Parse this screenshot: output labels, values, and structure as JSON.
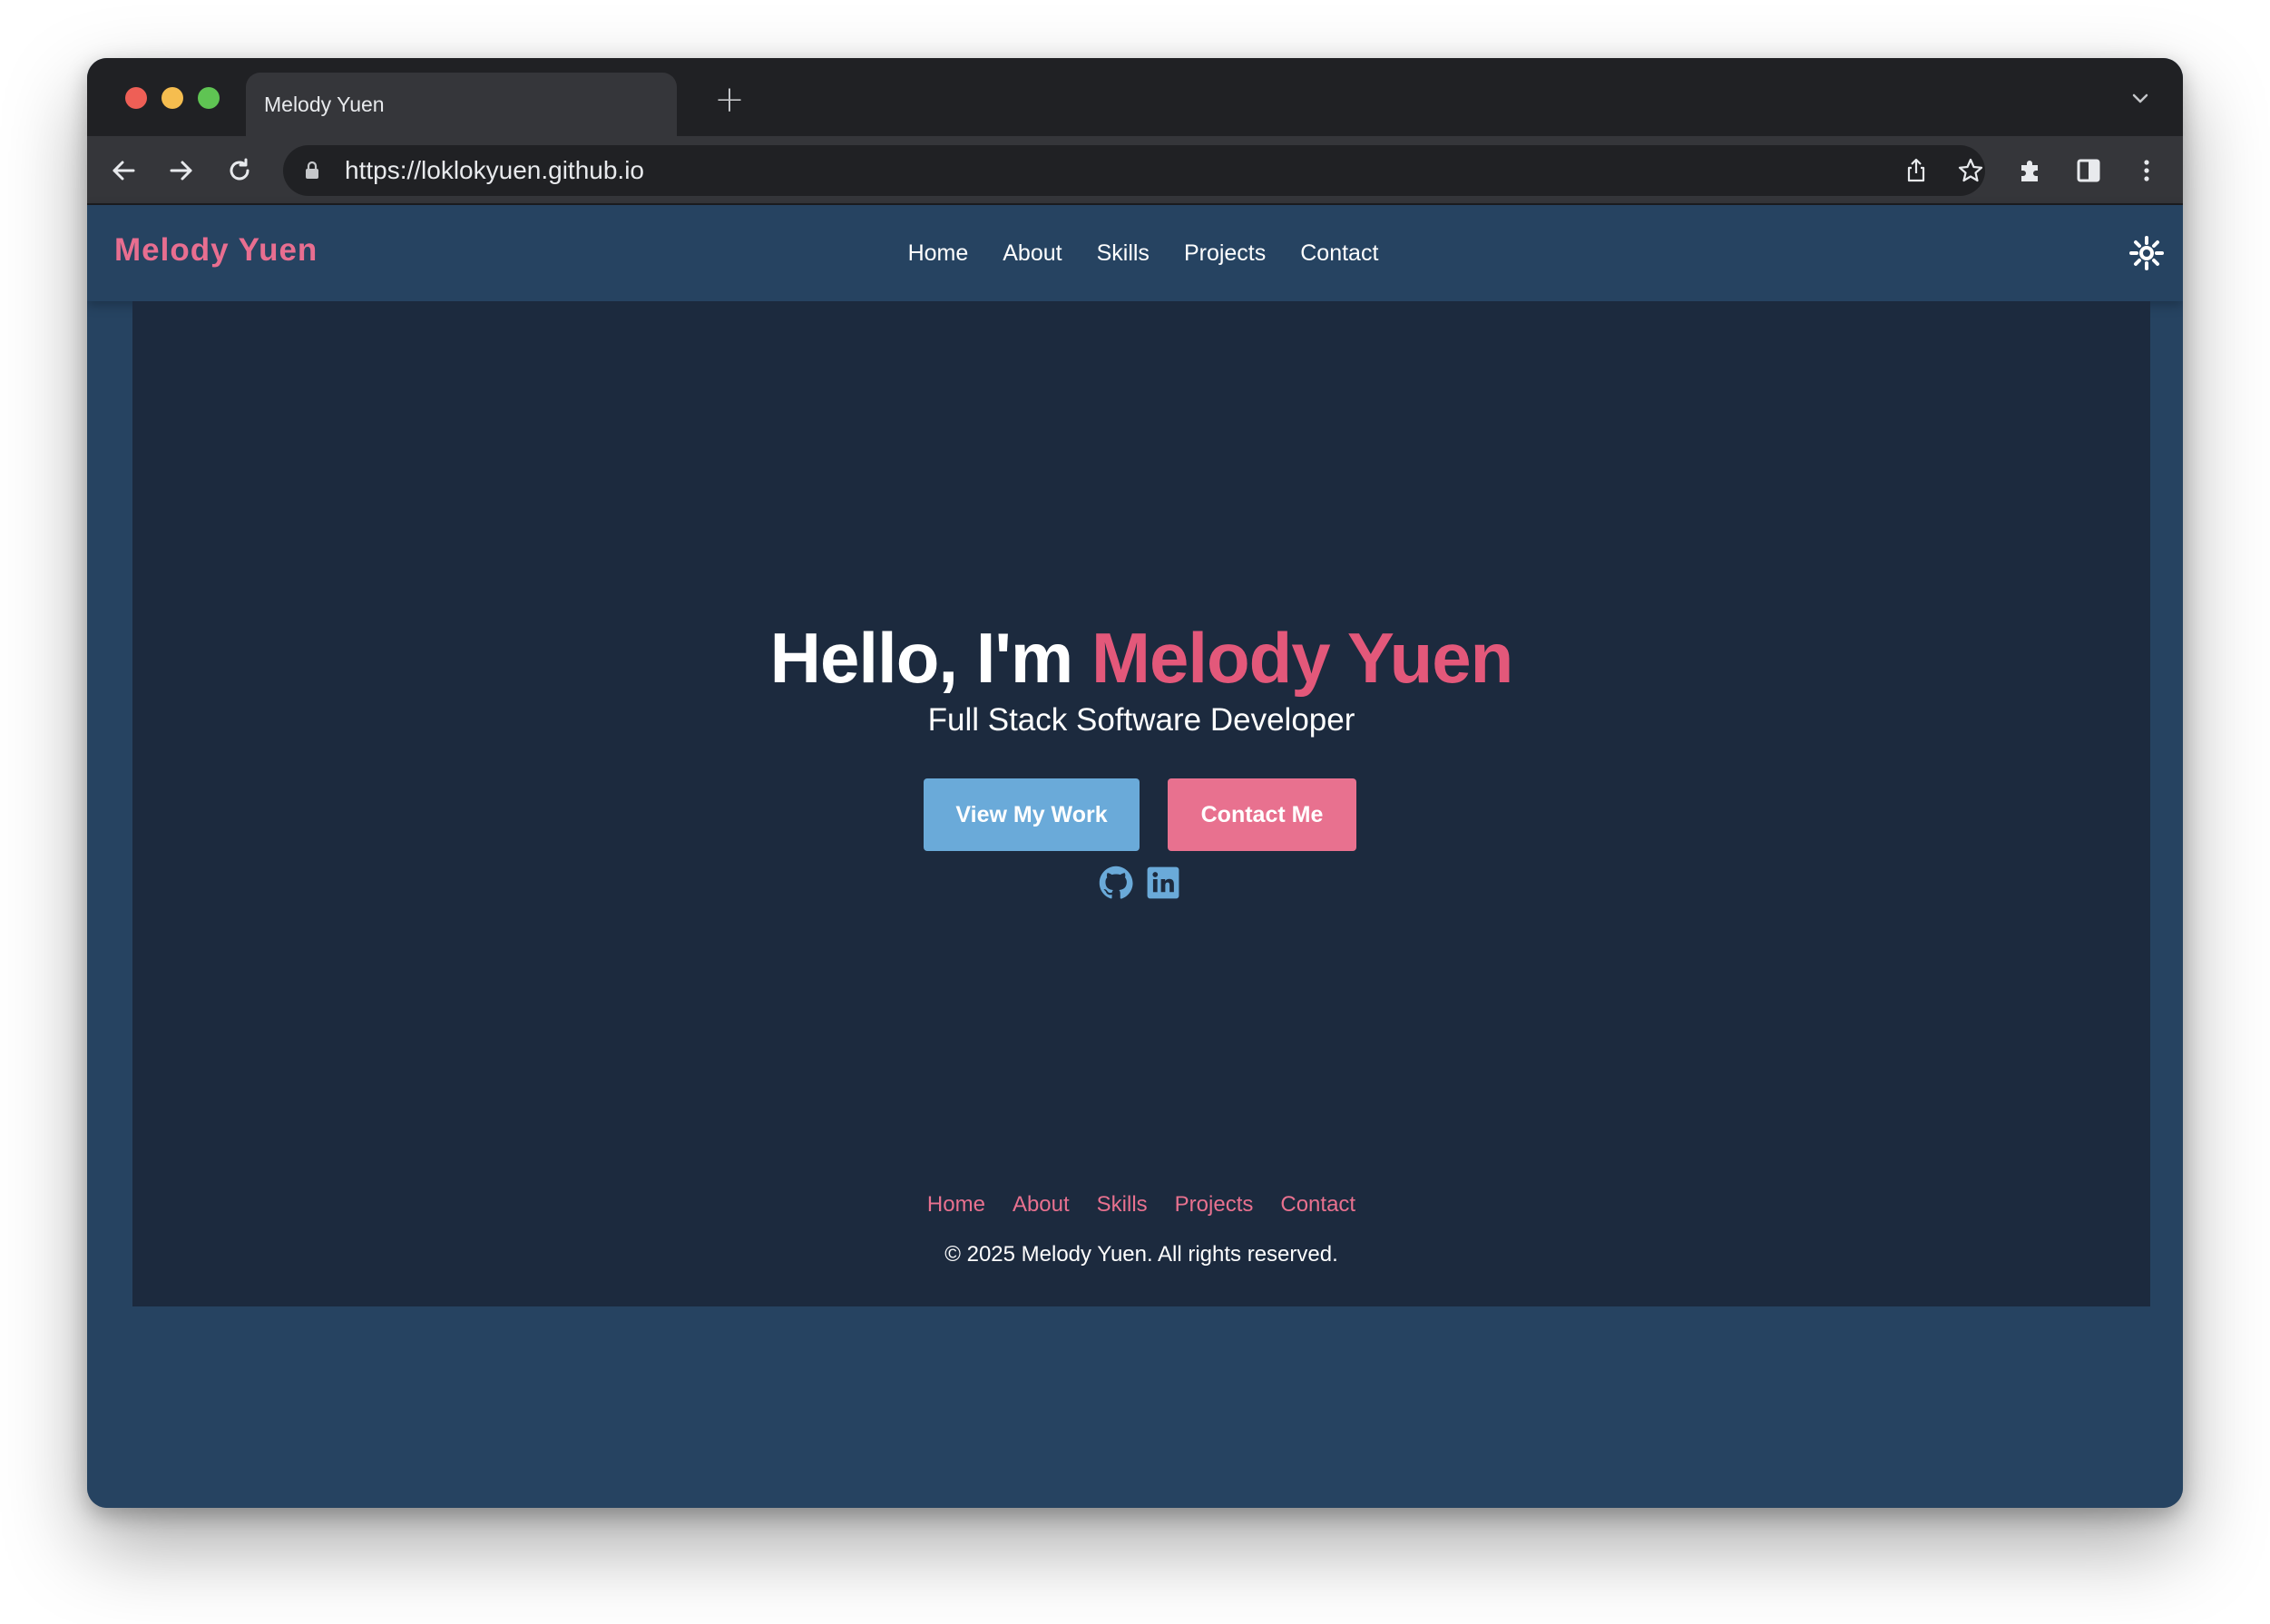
{
  "browser": {
    "tab_title": "Melody Yuen",
    "new_tab_symbol": "+",
    "url": "https://loklokyuen.github.io",
    "icons": [
      "back-icon",
      "forward-icon",
      "reload-icon",
      "lock-icon",
      "share-icon",
      "bookmark-star-icon",
      "extensions-icon",
      "side-panel-icon",
      "menu-icon",
      "tab-search-chevron-icon"
    ]
  },
  "site": {
    "brand": "Melody Yuen",
    "nav": [
      "Home",
      "About",
      "Skills",
      "Projects",
      "Contact"
    ],
    "theme_toggle_icon": "sun-icon",
    "hero": {
      "greeting": "Hello, I'm ",
      "name": "Melody Yuen",
      "subtitle": "Full Stack Software Developer",
      "primary_button": "View My Work",
      "secondary_button": "Contact Me",
      "social_icons": [
        "github-icon",
        "linkedin-icon"
      ]
    },
    "footer": {
      "links": [
        "Home",
        "About",
        "Skills",
        "Projects",
        "Contact"
      ],
      "copyright": "© 2025 Melody Yuen. All rights reserved."
    }
  },
  "colors": {
    "page_bg": "#264361",
    "hero_bg": "#1c2a3e",
    "accent_pink": "#e3587a",
    "button_blue": "#6aaad9",
    "button_pink": "#e8718f"
  }
}
